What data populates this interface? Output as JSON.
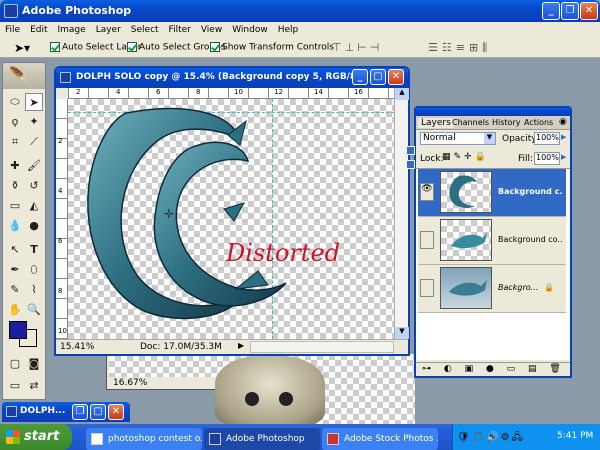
{
  "app": {
    "title": "Adobe Photoshop"
  },
  "menu": [
    "File",
    "Edit",
    "Image",
    "Layer",
    "Select",
    "Filter",
    "View",
    "Window",
    "Help"
  ],
  "options": {
    "auto_select_layer": "Auto Select Layer",
    "auto_select_groups": "Auto Select Groups",
    "show_transform": "Show Transform Controls"
  },
  "doc": {
    "title": "DOLPH SOLO copy @ 15.4% (Background copy 5, RGB/8)",
    "zoom": "15.41%",
    "info": "Doc: 17.0M/35.3M",
    "text_layer": "Distorted",
    "ruler_top": [
      "2",
      "4",
      "6",
      "8",
      "10",
      "12",
      "14",
      "16"
    ],
    "ruler_left": [
      "2",
      "4",
      "6",
      "8",
      "10"
    ]
  },
  "doc2": {
    "zoom": "16.67%"
  },
  "minimized": {
    "title": "DOLPH..."
  },
  "layers": {
    "tabs": [
      "Layers",
      "Channels",
      "History",
      "Actions"
    ],
    "blend_mode": "Normal",
    "opacity_label": "Opacity:",
    "opacity": "100%",
    "lock_label": "Lock:",
    "fill_label": "Fill:",
    "fill": "100%",
    "items": [
      {
        "name": "Background c...",
        "selected": true
      },
      {
        "name": "Background co..."
      },
      {
        "name": "Backgro..."
      }
    ]
  },
  "taskbar": {
    "start": "start",
    "items": [
      "photoshop contest o...",
      "Adobe Photoshop",
      "Adobe Stock Photos ..."
    ],
    "clock": "5:41 PM"
  },
  "colors": {
    "foreground": "#1c1e9e",
    "background": "#ffffff",
    "text": "#d0112b"
  }
}
